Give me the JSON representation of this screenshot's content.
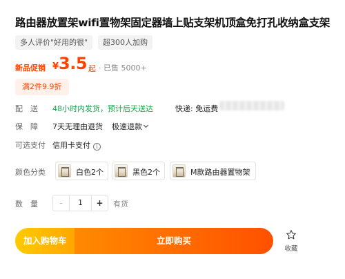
{
  "product": {
    "title": "路由器放置架wifi置物架固定器墙上贴支架机顶盒免打孔收纳盒支架",
    "tags": [
      "多人评价\"好用的很\"",
      "超300人加购"
    ]
  },
  "price": {
    "promo_label": "新品促销",
    "currency": "¥",
    "amount": "3.5",
    "unit": "起",
    "sold": "· 已售 5000+"
  },
  "coupon": {
    "label": "满2件9.9折"
  },
  "shipping": {
    "label": "配　送",
    "value": "48小时内发货，预计后天送达",
    "express": "快递: 免运费"
  },
  "guarantee": {
    "label": "保　障",
    "value": "7天无理由退货",
    "refund": "极速退款"
  },
  "payment": {
    "label": "可选支付",
    "value": "信用卡支付"
  },
  "color": {
    "label": "颜色分类",
    "options": [
      {
        "label": "白色2个"
      },
      {
        "label": "黑色2个"
      },
      {
        "label": "M款路由器置物架"
      }
    ]
  },
  "quantity": {
    "label": "数　量",
    "minus": "-",
    "value": "1",
    "plus": "+",
    "stock": "有货"
  },
  "actions": {
    "add_to_cart": "加入购物车",
    "buy_now": "立即购买",
    "favorite": "收藏"
  },
  "colors": {
    "accent": "#ff4400",
    "shipping_green": "#1aa34a",
    "cart_button": "#ffb400",
    "buy_button": "#ff5a00"
  },
  "icons": {
    "refund_dropdown": "chevron-down-icon",
    "payment_info": "info-icon",
    "favorite": "star-icon"
  }
}
